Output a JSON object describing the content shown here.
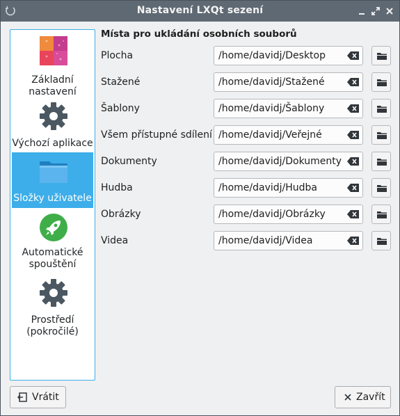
{
  "window": {
    "title": "Nastavení LXQt sezení",
    "controls": [
      "minimize-icon",
      "restore-icon",
      "close-icon"
    ]
  },
  "sidebar": {
    "items": [
      {
        "label_line1": "Základní",
        "label_line2": "nastavení",
        "icon": "basic-settings-icon"
      },
      {
        "label_line1": "Výchozí aplikace",
        "label_line2": "",
        "icon": "gear-icon"
      },
      {
        "label_line1": "Složky uživatele",
        "label_line2": "",
        "icon": "folder-icon",
        "active": true
      },
      {
        "label_line1": "Automatické",
        "label_line2": "spouštění",
        "icon": "rocket-icon"
      },
      {
        "label_line1": "Prostředí",
        "label_line2": "(pokročilé)",
        "icon": "gear-icon"
      }
    ]
  },
  "main": {
    "section_title": "Místa pro ukládání osobních souborů",
    "folders": [
      {
        "label": "Plocha",
        "value": "/home/davidj/Desktop"
      },
      {
        "label": "Stažené",
        "value": "/home/davidj/Stažené"
      },
      {
        "label": "Šablony",
        "value": "/home/davidj/Šablony"
      },
      {
        "label": "Všem přístupné sdílení",
        "value": "/home/davidj/Veřejné"
      },
      {
        "label": "Dokumenty",
        "value": "/home/davidj/Dokumenty"
      },
      {
        "label": "Hudba",
        "value": "/home/davidj/Hudba"
      },
      {
        "label": "Obrázky",
        "value": "/home/davidj/Obrázky"
      },
      {
        "label": "Videa",
        "value": "/home/davidj/Videa"
      }
    ]
  },
  "footer": {
    "revert_label": "Vrátit",
    "close_label": "Zavřít"
  },
  "colors": {
    "accent": "#3daee9",
    "titlebar": "#5f6973",
    "window_bg": "#eff0f1"
  }
}
